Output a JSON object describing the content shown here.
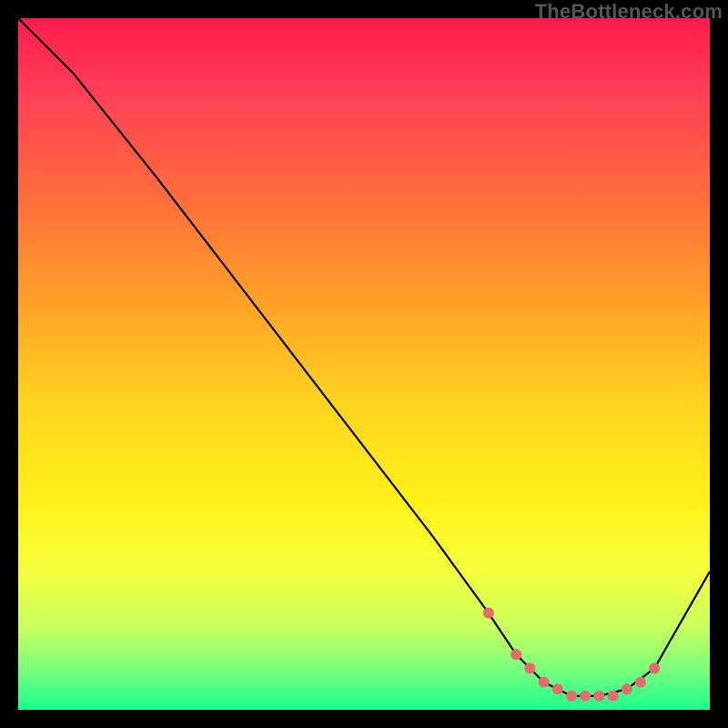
{
  "watermark": "TheBottleneck.com",
  "colors": {
    "dot": "#e86b6b",
    "line": "#000000"
  },
  "chart_data": {
    "type": "line",
    "title": "",
    "xlabel": "",
    "ylabel": "",
    "xlim": [
      0,
      100
    ],
    "ylim": [
      0,
      100
    ],
    "grid": false,
    "legend": false,
    "series": [
      {
        "name": "curve",
        "x": [
          0,
          8,
          20,
          30,
          40,
          50,
          60,
          68,
          72,
          76,
          80,
          84,
          88,
          92,
          100
        ],
        "y": [
          100,
          92,
          77,
          64,
          51,
          38,
          25,
          14,
          8,
          4,
          2,
          2,
          3,
          6,
          20
        ]
      }
    ],
    "markers": {
      "name": "highlight-dots",
      "x": [
        68,
        72,
        74,
        76,
        78,
        80,
        82,
        84,
        86,
        88,
        90,
        92
      ],
      "y": [
        14,
        8,
        6,
        4,
        3,
        2,
        2,
        2,
        2,
        3,
        4,
        6
      ]
    }
  }
}
